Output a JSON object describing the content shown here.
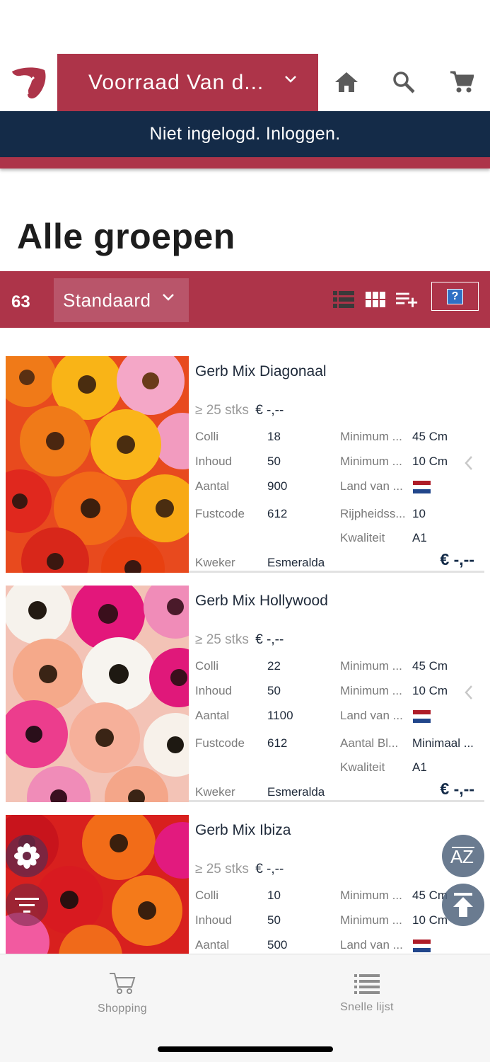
{
  "header": {
    "store_label": "Voorraad Van d...",
    "icons": [
      "logo-icon",
      "home-icon",
      "search-icon",
      "cart-icon"
    ]
  },
  "login_bar": {
    "text": "Niet ingelogd. Inloggen."
  },
  "page_title": "Alle groepen",
  "toolbar": {
    "count": "63",
    "sort_label": "Standaard",
    "help_label": "?",
    "icons": [
      "list-view-icon",
      "grid-view-icon",
      "add-to-list-icon"
    ]
  },
  "colors": {
    "brand_red": "#ad3449",
    "navy": "#142b48"
  },
  "products": [
    {
      "name": "Gerb Mix Diagonaal",
      "tier_label": "≥ 25 stks",
      "tier_price": "€ -,--",
      "left": [
        {
          "label": "Colli",
          "value": "18"
        },
        {
          "label": "Inhoud",
          "value": "50"
        },
        {
          "label": "Aantal",
          "value": "900"
        },
        {
          "label": "Fustcode",
          "value": "612"
        }
      ],
      "right": [
        {
          "label": "Minimum ...",
          "value": "45 Cm"
        },
        {
          "label": "Minimum ...",
          "value": "10 Cm"
        },
        {
          "label": "Land van ...",
          "value": "flag-nl"
        },
        {
          "label": "Rijpheidss...",
          "value": "10"
        },
        {
          "label": "Kwaliteit",
          "value": "A1"
        }
      ],
      "grower_label": "Kweker",
      "grower": "Esmeralda",
      "price": "€ -,--"
    },
    {
      "name": "Gerb Mix Hollywood",
      "tier_label": "≥ 25 stks",
      "tier_price": "€ -,--",
      "left": [
        {
          "label": "Colli",
          "value": "22"
        },
        {
          "label": "Inhoud",
          "value": "50"
        },
        {
          "label": "Aantal",
          "value": "1100"
        },
        {
          "label": "Fustcode",
          "value": "612"
        }
      ],
      "right": [
        {
          "label": "Minimum ...",
          "value": "45 Cm"
        },
        {
          "label": "Minimum ...",
          "value": "10 Cm"
        },
        {
          "label": "Land van ...",
          "value": "flag-nl"
        },
        {
          "label": "Aantal Bl...",
          "value": "Minimaal ..."
        },
        {
          "label": "Kwaliteit",
          "value": "A1"
        }
      ],
      "grower_label": "Kweker",
      "grower": "Esmeralda",
      "price": "€ -,--"
    },
    {
      "name": "Gerb Mix Ibiza",
      "tier_label": "≥ 25 stks",
      "tier_price": "€ -,--",
      "left": [
        {
          "label": "Colli",
          "value": "10"
        },
        {
          "label": "Inhoud",
          "value": "50"
        },
        {
          "label": "Aantal",
          "value": "500"
        }
      ],
      "right": [
        {
          "label": "Minimum ...",
          "value": "45 Cm"
        },
        {
          "label": "Minimum ...",
          "value": "10 Cm"
        },
        {
          "label": "Land van ...",
          "value": "flag-nl"
        }
      ]
    }
  ],
  "tabs": [
    {
      "label": "Shopping",
      "icon": "cart-outline-icon"
    },
    {
      "label": "Snelle lijst",
      "icon": "list-icon"
    }
  ],
  "fabs": [
    "flower-filter-icon",
    "filter-icon",
    "sort-az-icon",
    "scroll-top-icon"
  ]
}
